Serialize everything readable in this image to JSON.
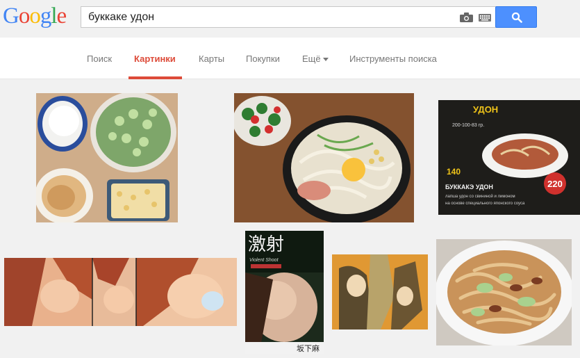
{
  "logo": {
    "letters": [
      "G",
      "o",
      "o",
      "g",
      "l",
      "e"
    ],
    "colors": [
      "#4285f4",
      "#ea4335",
      "#fbbc05",
      "#4285f4",
      "#34a853",
      "#ea4335"
    ]
  },
  "search": {
    "query": "буккаке удон",
    "button_icon": "search-icon"
  },
  "nav": {
    "items": [
      {
        "label": "Поиск",
        "active": false
      },
      {
        "label": "Картинки",
        "active": true
      },
      {
        "label": "Карты",
        "active": false
      },
      {
        "label": "Покупки",
        "active": false
      },
      {
        "label": "Ещё",
        "active": false
      },
      {
        "label": "Инструменты поиска",
        "active": false
      }
    ]
  },
  "results": {
    "menu_card": {
      "title": "УДОН",
      "subtitle": "200-100-83 гр.",
      "price_left": "140",
      "price_right": "220",
      "dish_name": "БУККАКЭ УДОН",
      "desc_line1": "лапша удон со свининой и лимоном",
      "desc_line2": "на основе специального японского соуса"
    },
    "cover": {
      "title": "激射",
      "subtitle": "Violent Shoot",
      "author": "坂下麻"
    }
  },
  "accent_color": "#dd4b39",
  "button_color": "#4d90fe"
}
